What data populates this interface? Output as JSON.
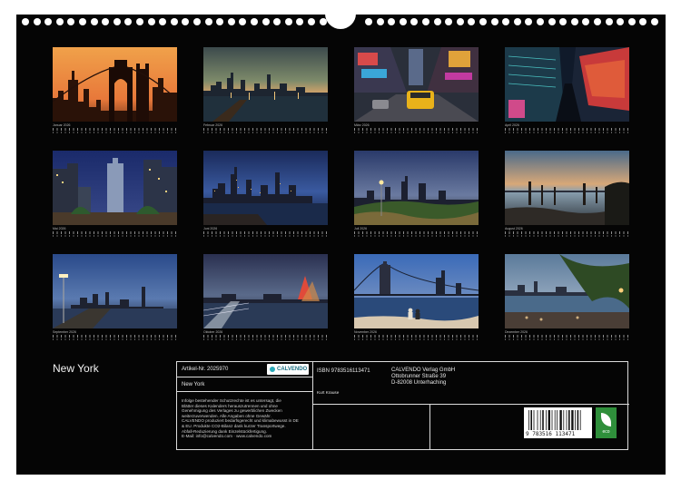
{
  "cover": {
    "title": "New York"
  },
  "months": [
    {
      "label": "Januar",
      "year": "2026"
    },
    {
      "label": "Februar",
      "year": "2026"
    },
    {
      "label": "März",
      "year": "2026"
    },
    {
      "label": "April",
      "year": "2026"
    },
    {
      "label": "Mai",
      "year": "2026"
    },
    {
      "label": "Juni",
      "year": "2026"
    },
    {
      "label": "Juli",
      "year": "2026"
    },
    {
      "label": "August",
      "year": "2026"
    },
    {
      "label": "September",
      "year": "2026"
    },
    {
      "label": "Oktober",
      "year": "2026"
    },
    {
      "label": "November",
      "year": "2026"
    },
    {
      "label": "Dezember",
      "year": "2026"
    }
  ],
  "info": {
    "article_no": "Artikel-Nr. 2025970",
    "publisher_logo": "CALVENDO",
    "title": "New York",
    "legal_text": "Infolge bestehender Schutzrechte ist es untersagt, die\nBlätter dieses Kalenders herauszutrennen und ohne\nGenehmigung des Verlages zu gewerblichen Zwecken\nweiterzuverwenden. Alle Angaben ohne Gewähr.\nCALVENDO produziert bedarfsgerecht und klimabewusst in DE\n& EU. Produkte CO2-Bilanz dank kurzer Transportwege.\nAbfall-Reduzierung dank Einzelstückfertigung.\nE-Mail: info@calvendo.com · www.calvendo.com",
    "isbn": "ISBN 9783516113471",
    "author": "Kurt Krause",
    "publisher": [
      "CALVENDO Verlag GmbH",
      "Ottobrunner Straße 39",
      "D-82008 Unterhaching"
    ],
    "barcode_number": "9 783516 113471",
    "eco_label": "eco"
  }
}
